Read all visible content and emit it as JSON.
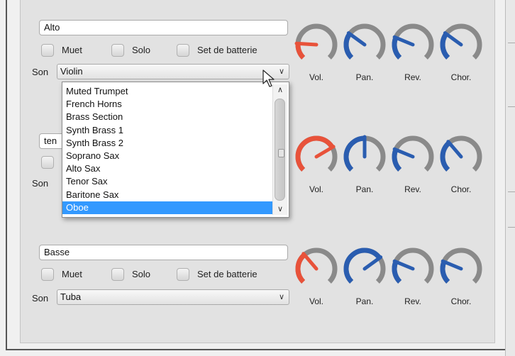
{
  "tracks": [
    {
      "name": "Alto",
      "mute_label": "Muet",
      "solo_label": "Solo",
      "drumset_label": "Set de batterie",
      "sound_label": "Son",
      "sound_value": "Violin",
      "knobs": [
        {
          "label": "Vol.",
          "value": 0.18,
          "color": "#e8523a"
        },
        {
          "label": "Pan.",
          "value": 0.3,
          "color": "#2a5db0"
        },
        {
          "label": "Rev.",
          "value": 0.25,
          "color": "#2a5db0"
        },
        {
          "label": "Chor.",
          "value": 0.3,
          "color": "#2a5db0"
        }
      ]
    },
    {
      "name": "ten",
      "sound_label": "Son",
      "knobs": [
        {
          "label": "Vol.",
          "value": 0.72,
          "color": "#e8523a"
        },
        {
          "label": "Pan.",
          "value": 0.5,
          "color": "#2a5db0"
        },
        {
          "label": "Rev.",
          "value": 0.25,
          "color": "#2a5db0"
        },
        {
          "label": "Chor.",
          "value": 0.35,
          "color": "#2a5db0"
        }
      ]
    },
    {
      "name": "Basse",
      "mute_label": "Muet",
      "solo_label": "Solo",
      "drumset_label": "Set de batterie",
      "sound_label": "Son",
      "sound_value": "Tuba",
      "knobs": [
        {
          "label": "Vol.",
          "value": 0.35,
          "color": "#e8523a"
        },
        {
          "label": "Pan.",
          "value": 0.7,
          "color": "#2a5db0"
        },
        {
          "label": "Rev.",
          "value": 0.25,
          "color": "#2a5db0"
        },
        {
          "label": "Chor.",
          "value": 0.25,
          "color": "#2a5db0"
        }
      ]
    }
  ],
  "dropdown": {
    "items": [
      "Muted Trumpet",
      "French Horns",
      "Brass Section",
      "Synth Brass 1",
      "Synth Brass 2",
      "Soprano Sax",
      "Alto Sax",
      "Tenor Sax",
      "Baritone Sax",
      "Oboe"
    ],
    "selected_index": 9
  },
  "icons": {
    "dropdown_arrow": "chevron-down-icon",
    "scroll_up": "chevron-up-icon",
    "cursor": "mouse-pointer-icon"
  }
}
